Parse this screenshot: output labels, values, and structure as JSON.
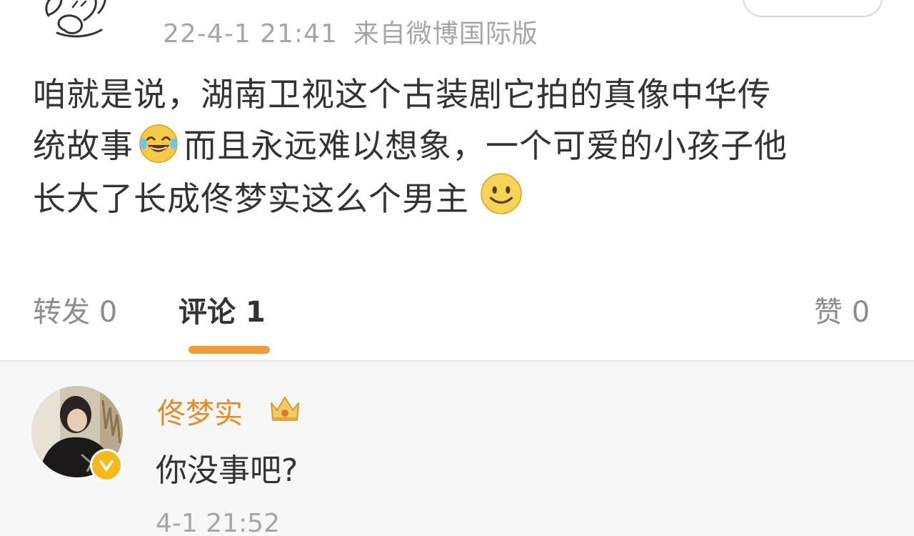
{
  "post": {
    "timestamp": "22-4-1 21:41",
    "source": "来自微博国际版",
    "body_line1": "咱就是说，湖南卫视这个古装剧它拍的真像中华传",
    "body_line2_a": "统故事",
    "body_line2_b": "而且永远难以想象，一个可爱的小孩子他",
    "body_line3": "长大了长成佟梦实这么个男主",
    "emojis": [
      "laughing-tears-icon",
      "smile-icon"
    ]
  },
  "tabs": {
    "repost": "转发 0",
    "comment": "评论 1",
    "like": "赞 0",
    "active": "comment"
  },
  "comment": {
    "author": "佟梦实",
    "text": "你没事吧?",
    "time": "4-1 21:52",
    "icons": [
      "crown-icon",
      "verified-badge-icon"
    ]
  },
  "colors": {
    "accent": "#f29a3a",
    "author_name": "#e58b2a",
    "muted_text": "#a6a6a6",
    "body_text": "#333333"
  }
}
